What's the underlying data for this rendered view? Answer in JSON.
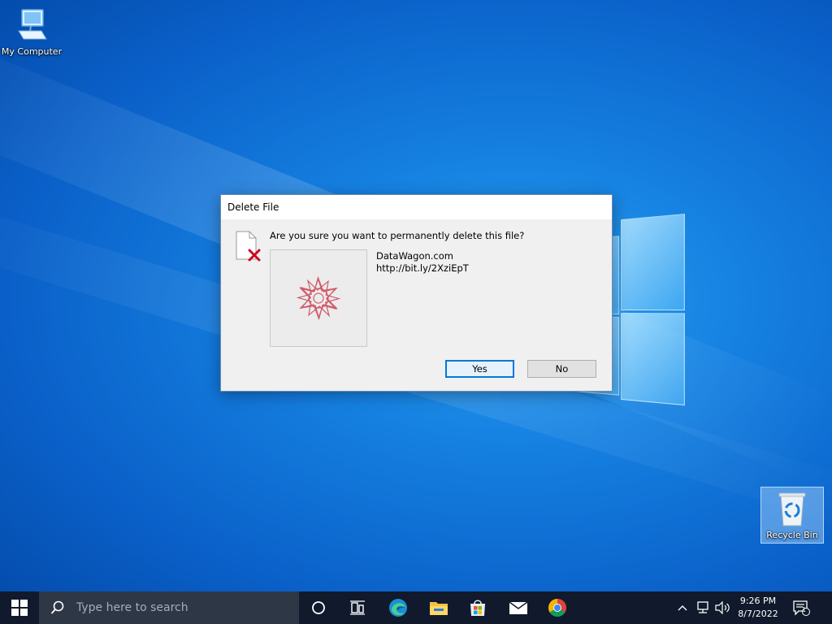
{
  "desktop": {
    "icons": [
      {
        "label": "My Computer",
        "icon": "computer-icon"
      },
      {
        "label": "Recycle Bin",
        "icon": "recycle-bin-icon"
      }
    ]
  },
  "dialog": {
    "title": "Delete File",
    "question": "Are you sure you want to permanently delete this file?",
    "file_name": "DataWagon.com",
    "file_detail": "http://bit.ly/2XziEpT",
    "yes_label": "Yes",
    "no_label": "No"
  },
  "taskbar": {
    "search_placeholder": "Type here to search",
    "pinned": [
      "cortana-icon",
      "task-view-icon",
      "edge-icon",
      "file-explorer-icon",
      "store-icon",
      "mail-icon",
      "chrome-icon"
    ],
    "clock_time": "9:26 PM",
    "clock_date": "8/7/2022",
    "notification_count": "1"
  },
  "colors": {
    "accent": "#0078d7",
    "taskbar": "#101a2c",
    "delete_x": "#d0021b"
  }
}
